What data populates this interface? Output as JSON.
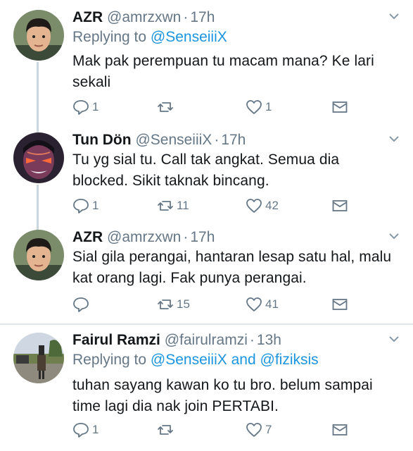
{
  "tweets": [
    {
      "name": "AZR",
      "handle": "@amrzxwn",
      "time": "17h",
      "replying_prefix": "Replying to",
      "replying_to": "@SenseiiiX",
      "replying_and": "",
      "replying_to2": "",
      "text": "Mak pak perempuan tu macam mana? Ke lari sekali",
      "replies": "1",
      "retweets": "",
      "likes": "1"
    },
    {
      "name": "Tun Dön",
      "handle": "@SenseiiiX",
      "time": "17h",
      "text": "Tu yg sial tu. Call tak angkat. Semua dia blocked. Sikit taknak bincang.",
      "replies": "1",
      "retweets": "11",
      "likes": "42"
    },
    {
      "name": "AZR",
      "handle": "@amrzxwn",
      "time": "17h",
      "text": "Sial gila perangai, hantaran lesap satu hal, malu kat orang lagi. Fak punya perangai.",
      "replies": "",
      "retweets": "15",
      "likes": "41"
    },
    {
      "name": "Fairul Ramzi",
      "handle": "@fairulramzi",
      "time": "13h",
      "replying_prefix": "Replying to",
      "replying_to": "@SenseiiiX",
      "replying_and": "and",
      "replying_to2": "@fiziksis",
      "text": "tuhan sayang kawan ko tu bro. belum sampai time lagi dia nak join PERTABI.",
      "replies": "1",
      "retweets": "",
      "likes": "7"
    }
  ],
  "icons": {
    "reply": "reply-icon",
    "retweet": "retweet-icon",
    "like": "heart-icon",
    "dm": "envelope-icon",
    "more": "chevron-down-icon"
  },
  "colors": {
    "link": "#1b95e0",
    "muted": "#657786",
    "thread_line": "#ccd6dd"
  }
}
